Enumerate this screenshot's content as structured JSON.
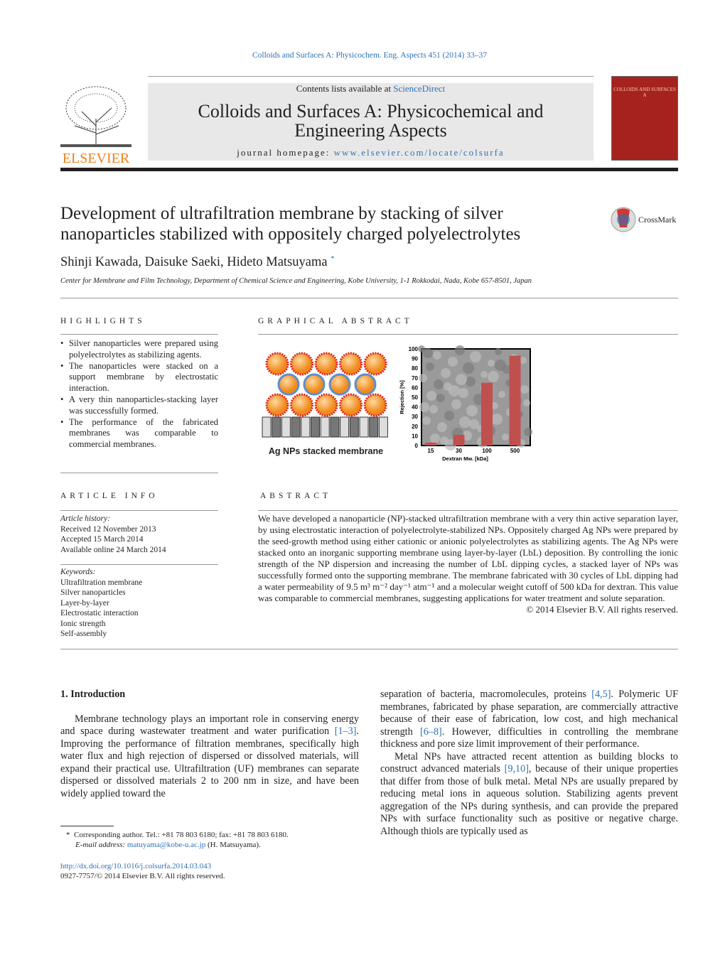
{
  "journal_ref": "Colloids and Surfaces A: Physicochem. Eng. Aspects 451 (2014) 33–37",
  "header": {
    "contents_prefix": "Contents lists available at ",
    "contents_link": "ScienceDirect",
    "journal_title_1": "Colloids and Surfaces A: Physicochemical and",
    "journal_title_2": "Engineering Aspects",
    "homepage_prefix": "journal homepage: ",
    "homepage_link": "www.elsevier.com/locate/colsurfa",
    "publisher": "ELSEVIER",
    "cover_title": "COLLOIDS AND SURFACES A"
  },
  "crossmark": "CrossMark",
  "article": {
    "title": "Development of ultrafiltration membrane by stacking of silver nanoparticles stabilized with oppositely charged polyelectrolytes",
    "authors": "Shinji Kawada, Daisuke Saeki, Hideto Matsuyama",
    "author_mark": "*",
    "affiliation": "Center for Membrane and Film Technology, Department of Chemical Science and Engineering, Kobe University, 1-1 Rokkodai, Nada, Kobe 657-8501, Japan"
  },
  "highlights": {
    "heading": "Highlights",
    "items": [
      "Silver nanoparticles were prepared using polyelectrolytes as stabilizing agents.",
      "The nanoparticles were stacked on a support membrane by electrostatic interaction.",
      "A very thin nanoparticles-stacking layer was successfully formed.",
      "The performance of the fabricated membranes was comparable to commercial membranes."
    ]
  },
  "graphical_abstract": {
    "heading": "Graphical abstract",
    "figure_label": "Ag NPs stacked membrane"
  },
  "chart_data": {
    "type": "bar",
    "categories": [
      "15",
      "30",
      "100",
      "500"
    ],
    "values": [
      3,
      11,
      65,
      93
    ],
    "xlabel": "Dextran Mw. [kDa]",
    "ylabel": "Rejection [%]",
    "ylim": [
      0,
      100
    ],
    "yticks": [
      0,
      10,
      20,
      30,
      40,
      50,
      60,
      70,
      80,
      90,
      100
    ],
    "bar_color": "#c0504d"
  },
  "article_info": {
    "heading": "Article info",
    "history_label": "Article history:",
    "history": [
      "Received 12 November 2013",
      "Accepted 15 March 2014",
      "Available online 24 March 2014"
    ],
    "keywords_label": "Keywords:",
    "keywords": [
      "Ultrafiltration membrane",
      "Silver nanoparticles",
      "Layer-by-layer",
      "Electrostatic interaction",
      "Ionic strength",
      "Self-assembly"
    ]
  },
  "abstract": {
    "heading": "Abstract",
    "text": "We have developed a nanoparticle (NP)-stacked ultrafiltration membrane with a very thin active separation layer, by using electrostatic interaction of polyelectrolyte-stabilized NPs. Oppositely charged Ag NPs were prepared by the seed-growth method using either cationic or anionic polyelectrolytes as stabilizing agents. The Ag NPs were stacked onto an inorganic supporting membrane using layer-by-layer (LbL) deposition. By controlling the ionic strength of the NP dispersion and increasing the number of LbL dipping cycles, a stacked layer of NPs was successfully formed onto the supporting membrane. The membrane fabricated with 30 cycles of LbL dipping had a water permeability of 9.5 m³ m⁻² day⁻¹ atm⁻¹ and a molecular weight cutoff of 500 kDa for dextran. This value was comparable to commercial membranes, suggesting applications for water treatment and solute separation.",
    "copyright": "© 2014 Elsevier B.V. All rights reserved."
  },
  "intro": {
    "heading": "1.  Introduction",
    "p1a": "Membrane technology plays an important role in conserving energy and space during wastewater treatment and water purification ",
    "ref1": "[1–3]",
    "p1b": ". Improving the performance of filtration membranes, specifically high water flux and high rejection of dispersed or dissolved materials, will expand their practical use. Ultrafiltration (UF) membranes can separate dispersed or dissolved materials 2 to 200 nm in size, and have been widely applied toward the",
    "p1c": "separation of bacteria, macromolecules, proteins ",
    "ref2": "[4,5]",
    "p1d": ". Polymeric UF membranes, fabricated by phase separation, are commercially attractive because of their ease of fabrication, low cost, and high mechanical strength ",
    "ref3": "[6–8]",
    "p1e": ". However, difficulties in controlling the membrane thickness and pore size limit improvement of their performance.",
    "p2a": "Metal NPs have attracted recent attention as building blocks to construct advanced materials ",
    "ref4": "[9,10]",
    "p2b": ", because of their unique properties that differ from those of bulk metal. Metal NPs are usually prepared by reducing metal ions in aqueous solution. Stabilizing agents prevent aggregation of the NPs during synthesis, and can provide the prepared NPs with surface functionality such as positive or negative charge. Although thiols are typically used as"
  },
  "footnote": {
    "mark": "*",
    "text": "Corresponding author. Tel.: +81 78 803 6180; fax: +81 78 803 6180.",
    "email_label": "E-mail address: ",
    "email": "matuyama@kobe-u.ac.jp",
    "email_suffix": " (H. Matsuyama)."
  },
  "doi": "http://dx.doi.org/10.1016/j.colsurfa.2014.03.043",
  "issn": "0927-7757/© 2014 Elsevier B.V. All rights reserved."
}
